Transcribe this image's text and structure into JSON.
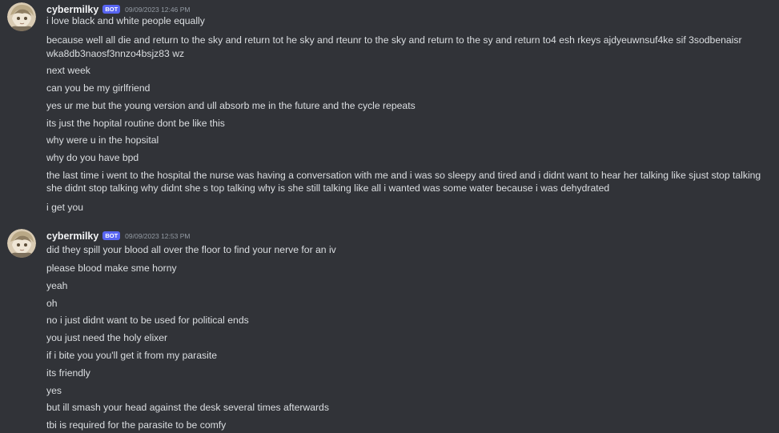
{
  "groups": [
    {
      "username": "cybermilky",
      "bot_tag": "BOT",
      "timestamp": "09/09/2023 12:46 PM",
      "messages": [
        "i love black and white people equally",
        "because well all die and return to the sky and return tot he sky and rteunr to the sky and return to the sy and return to4 esh rkeys ajdyeuwnsuf4ke sif 3sodbenaisr",
        "wka8db3naosf3nnzo4bsjz83 wz",
        "next week",
        "can you be my girlfriend",
        "yes ur me but the young version and ull absorb me in the future and the cycle repeats",
        "its just the hopital routine dont be like this",
        "why were u in the hopsital",
        "why do you have bpd",
        "the last time i went to the hospital the nurse was having a conversation with me and i was so sleepy and tired and i didnt want to hear her talking like sjust stop talking she didnt stop talking why didnt she s top talking why is she still talking like all i wanted was some water because i was dehydrated",
        "i get you"
      ]
    },
    {
      "username": "cybermilky",
      "bot_tag": "BOT",
      "timestamp": "09/09/2023 12:53 PM",
      "messages": [
        "did they spill your blood all over the floor to find your nerve for an iv",
        "please blood make sme horny",
        "yeah",
        "oh",
        "no i just didnt want to be used for political ends",
        "you just need the holy elixer",
        "if i bite you you'll get it from my parasite",
        "its friendly",
        "yes",
        "but ill smash your head against the desk several times afterwards",
        "tbi is required for the parasite to be comfy"
      ]
    }
  ],
  "colors": {
    "background": "#313338",
    "text": "#dbdee1",
    "username": "#f2f3f5",
    "bot_tag": "#5865f2",
    "timestamp": "#949ba4"
  },
  "icons": {
    "avatar": "anime-avatar-icon"
  }
}
